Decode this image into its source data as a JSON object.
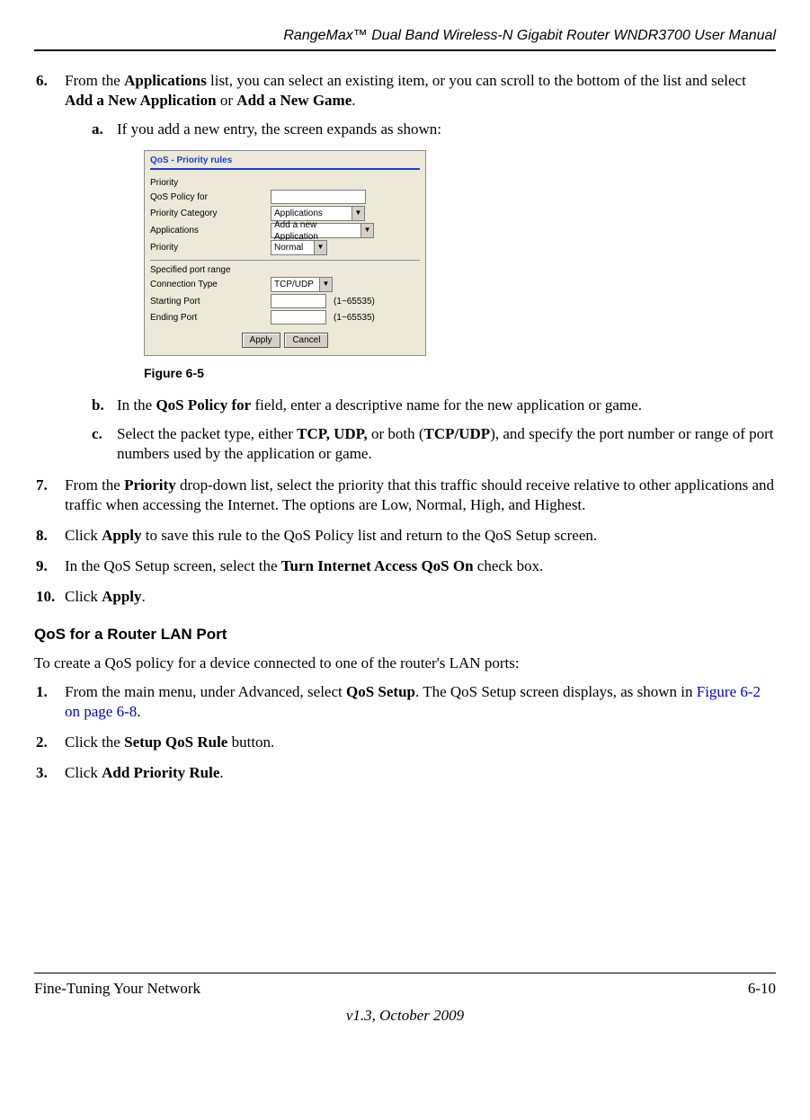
{
  "header": {
    "title": "RangeMax™ Dual Band Wireless-N Gigabit Router WNDR3700 User Manual"
  },
  "step6": {
    "num": "6.",
    "text_a": "From the ",
    "bold_a": "Applications",
    "text_b": " list, you can select an existing item, or you can scroll to the bottom of the list and select ",
    "bold_b": "Add a New Application",
    "text_c": " or ",
    "bold_c": "Add a New Game",
    "text_d": ".",
    "sub_a": {
      "num": "a.",
      "text": "If you add a new entry, the screen expands as shown:"
    },
    "sub_b": {
      "num": "b.",
      "text_a": "In the ",
      "bold_a": "QoS Policy for",
      "text_b": " field, enter a descriptive name for the new application or game."
    },
    "sub_c": {
      "num": "c.",
      "text_a": "Select the packet type, either ",
      "bold_a": "TCP, UDP,",
      "text_b": " or both (",
      "bold_b": "TCP/UDP",
      "text_c": "), and specify the port number or range of port numbers used by the application or game."
    }
  },
  "figure": {
    "title": "QoS - Priority rules",
    "labels": {
      "priority_section": "Priority",
      "qos_policy_for": "QoS Policy for",
      "priority_category": "Priority Category",
      "applications": "Applications",
      "priority": "Priority",
      "specified_range": "Specified port range",
      "connection_type": "Connection Type",
      "starting_port": "Starting Port",
      "ending_port": "Ending Port"
    },
    "values": {
      "priority_category": "Applications",
      "applications": "Add a new Application",
      "priority": "Normal",
      "connection_type": "TCP/UDP",
      "range": "(1~65535)"
    },
    "buttons": {
      "apply": "Apply",
      "cancel": "Cancel"
    },
    "caption": "Figure 6-5"
  },
  "step7": {
    "num": "7.",
    "text_a": "From the ",
    "bold_a": "Priority",
    "text_b": " drop-down list, select the priority that this traffic should receive relative to other applications and traffic when accessing the Internet. The options are Low, Normal, High, and Highest."
  },
  "step8": {
    "num": "8.",
    "text_a": "Click ",
    "bold_a": "Apply",
    "text_b": " to save this rule to the QoS Policy list and return to the QoS Setup screen."
  },
  "step9": {
    "num": "9.",
    "text_a": "In the QoS Setup screen, select the ",
    "bold_a": "Turn Internet Access QoS On",
    "text_b": " check box."
  },
  "step10": {
    "num": "10.",
    "text_a": "Click ",
    "bold_a": "Apply",
    "text_b": "."
  },
  "section2": {
    "heading": "QoS for a Router LAN Port",
    "intro": "To create a QoS policy for a device connected to one of the router's LAN ports:",
    "s1": {
      "num": "1.",
      "text_a": "From the main menu, under Advanced, select ",
      "bold_a": "QoS Setup",
      "text_b": ". The QoS Setup screen displays, as shown in ",
      "link": "Figure 6-2 on page 6-8",
      "text_c": "."
    },
    "s2": {
      "num": "2.",
      "text_a": "Click the ",
      "bold_a": "Setup QoS Rule",
      "text_b": " button."
    },
    "s3": {
      "num": "3.",
      "text_a": "Click ",
      "bold_a": "Add Priority Rule",
      "text_b": "."
    }
  },
  "footer": {
    "left": "Fine-Tuning Your Network",
    "right": "6-10",
    "version": "v1.3, October 2009"
  }
}
